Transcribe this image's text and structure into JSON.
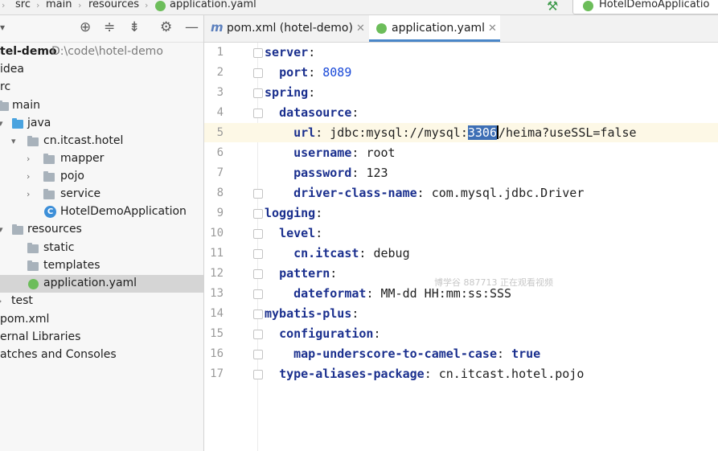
{
  "breadcrumb": [
    "src",
    "main",
    "resources",
    "application.yaml"
  ],
  "run_config": "HotelDemoApplicatio",
  "project_tree": [
    {
      "label": "tel-demo",
      "extra": "D:\\code\\hotel-demo",
      "type": "root"
    },
    {
      "label": "idea",
      "type": "folder"
    },
    {
      "label": "rc",
      "type": "folder"
    },
    {
      "label": "main",
      "type": "folder"
    },
    {
      "label": "java",
      "type": "folder-blue"
    },
    {
      "label": "cn.itcast.hotel",
      "type": "package"
    },
    {
      "label": "mapper",
      "type": "package"
    },
    {
      "label": "pojo",
      "type": "package"
    },
    {
      "label": "service",
      "type": "package"
    },
    {
      "label": "HotelDemoApplication",
      "type": "class"
    },
    {
      "label": "resources",
      "type": "resources"
    },
    {
      "label": "static",
      "type": "folder"
    },
    {
      "label": "templates",
      "type": "folder"
    },
    {
      "label": "application.yaml",
      "type": "yaml"
    },
    {
      "label": "test",
      "type": "folder"
    },
    {
      "label": "pom.xml",
      "type": "file"
    },
    {
      "label": "ernal Libraries",
      "type": "lib"
    },
    {
      "label": "atches and Consoles",
      "type": "lib"
    }
  ],
  "tabs": [
    {
      "label": "pom.xml (hotel-demo)",
      "icon": "maven-icon"
    },
    {
      "label": "application.yaml",
      "icon": "spring-leaf-icon"
    }
  ],
  "editor": {
    "line_numbers": [
      "1",
      "2",
      "3",
      "4",
      "5",
      "6",
      "7",
      "8",
      "9",
      "10",
      "11",
      "12",
      "13",
      "14",
      "15",
      "16",
      "17"
    ],
    "lines": {
      "l1_key": "server",
      "l2_key": "port",
      "l2_val": "8089",
      "l3_key": "spring",
      "l4_key": "datasource",
      "l5_key": "url",
      "l5_pre": "jdbc:mysql://mysql:",
      "l5_sel": "3306",
      "l5_post": "/heima?useSSL=false",
      "l6_key": "username",
      "l6_val": "root",
      "l7_key": "password",
      "l7_val": "123",
      "l8_key": "driver-class-name",
      "l8_val": "com.mysql.jdbc.Driver",
      "l9_key": "logging",
      "l10_key": "level",
      "l11_key": "cn.itcast",
      "l11_val": "debug",
      "l12_key": "pattern",
      "l13_key": "dateformat",
      "l13_val": "MM-dd HH:mm:ss:SSS",
      "l14_key": "mybatis-plus",
      "l15_key": "configuration",
      "l16_key": "map-underscore-to-camel-case",
      "l16_val": "true",
      "l17_key": "type-aliases-package",
      "l17_val": "cn.itcast.hotel.pojo"
    }
  },
  "watermark": "博学谷 887713 正在观看视频"
}
